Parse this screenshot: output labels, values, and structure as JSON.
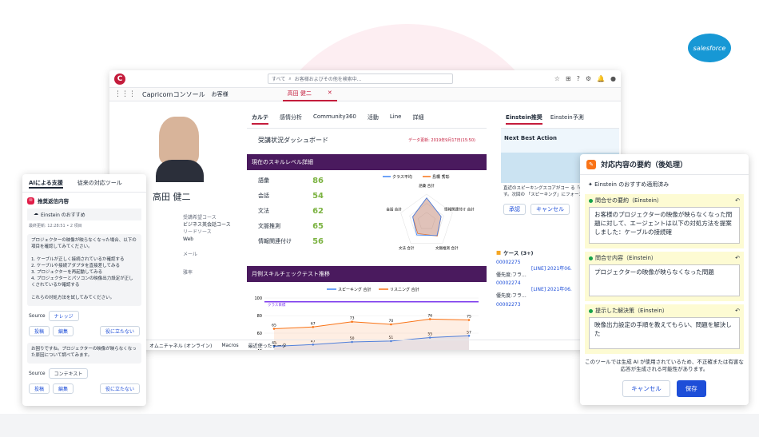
{
  "brand": {
    "logo_text": "salesforce"
  },
  "console": {
    "search_scope": "すべて",
    "search_placeholder": "お客様およびその他を検索中...",
    "app_title": "Capricornコンソール",
    "nav_object": "お客様",
    "record_tab": "高田 健二",
    "contact_name": "高田 健二",
    "info_labels": [
      "受講希望コース",
      "リードソース",
      "メール",
      "雅率"
    ],
    "info_values": [
      "ビジネス英会話コース",
      "Web",
      "",
      ""
    ],
    "tabs": [
      "カルテ",
      "感情分析",
      "Community360",
      "活動",
      "Line",
      "詳細"
    ],
    "dashboard_title": "受講状況ダッシュボード",
    "data_updated": "データ更新: 2019年9月17日(15:50)",
    "skill_header": "現在のスキルレベル詳細",
    "skills": [
      {
        "name": "語彙",
        "value": "86"
      },
      {
        "name": "会話",
        "value": "54"
      },
      {
        "name": "文法",
        "value": "62"
      },
      {
        "name": "文脈推測",
        "value": "65"
      },
      {
        "name": "情報関連付け",
        "value": "56"
      }
    ],
    "radar_legend": [
      "クラス平均",
      "島橋 秀彰"
    ],
    "monthly_header": "月例スキルチェックテスト推移",
    "footer_items": [
      "オムニチャネル (オンライン)",
      "Macros",
      "最近使ったデータ"
    ]
  },
  "chart_data": [
    {
      "type": "radar",
      "title": "",
      "categories": [
        "語彙 合計",
        "情報関連付け 合計",
        "文脈推測 合計",
        "文法 合計",
        "会話 合計"
      ],
      "series": [
        {
          "name": "クラス平均",
          "values": [
            86,
            56,
            65,
            62,
            54
          ]
        },
        {
          "name": "島橋 秀彰",
          "values": [
            86,
            56,
            67,
            56,
            54
          ]
        }
      ]
    },
    {
      "type": "line",
      "title": "",
      "categories": [
        "1",
        "2",
        "3",
        "4",
        "5",
        "6"
      ],
      "series": [
        {
          "name": "スピーキング 合計",
          "values": [
            45,
            47,
            50,
            51,
            55,
            57
          ]
        },
        {
          "name": "リスニング 合計",
          "values": [
            65,
            67,
            73,
            70,
            76,
            75
          ]
        }
      ],
      "ylim": [
        40,
        100
      ],
      "yticks": [
        40,
        60,
        80,
        100
      ],
      "reference_label": "クラス目標"
    }
  ],
  "right_panel": {
    "tabs": [
      "Einstein推奨",
      "Einstein予測"
    ],
    "nba_title": "Next Best Action",
    "nba_text": "直近のスピーキングスコアがコー る「67」となっています。次回の 「スピーキング」にフォーカスし",
    "accept": "承認",
    "cancel": "キャンセル",
    "cases_title": "ケース (3+)",
    "cases": [
      {
        "id": "00002275",
        "subject": "[LINE] 2021年06.",
        "priority": "優先度:フラ..."
      },
      {
        "id": "00002274",
        "subject": "[LINE] 2021年06.",
        "priority": "優先度:フラ..."
      },
      {
        "id": "00002273",
        "subject": "",
        "priority": ""
      }
    ]
  },
  "ai_panel": {
    "tabs": [
      "AIによる支援",
      "従来の対応ツール"
    ],
    "section": "推奨返信内容",
    "recommend": "Einstein のおすすめ",
    "timestamp": "最終更新: 12:28:51 • 2 項目",
    "message1": "プロジェクターの映像が映らなくなった場合、以下の項目を確認してみてください。\n\n1. ケーブルが正しく接続されているか確認する\n2. ケーブルや接続アダプタを直接差してみる\n3. プロジェクターを再起動してみる\n4. プロジェクターとパソコンの映像出力設定が正しくされているか確認する\n\nこれらの対処方法を試してみてください。",
    "source_label": "Source",
    "source1": "ナレッジ",
    "post": "投稿",
    "edit": "編集",
    "not_useful": "役に立たない",
    "message2": "お困りですね。プロジェクターの映像が映らなくなった原因について調べてみます。",
    "source2": "コンテキスト"
  },
  "summary": {
    "title": "対応内容の要約（後処理）",
    "applied": "Einstein のおすすめ適用済み",
    "fields": [
      {
        "label": "問合せの要約（Einstein）",
        "value": "お客様のプロジェクターの映像が映らなくなった問題に対して、エージェントは以下の対処方法を提案しました：ケーブルの接続確"
      },
      {
        "label": "問合せ内容（Einstein）",
        "value": "プロジェクターの映像が映らなくなった問題"
      },
      {
        "label": "提示した解決策（Einstein）",
        "value": "映像出力設定の手順を教えてもらい、問題を解決した"
      }
    ],
    "disclaimer": "このツールでは生成 AI が使用されているため、不正確または有害な応答が生成される可能性があります。",
    "cancel": "キャンセル",
    "save": "保存"
  }
}
